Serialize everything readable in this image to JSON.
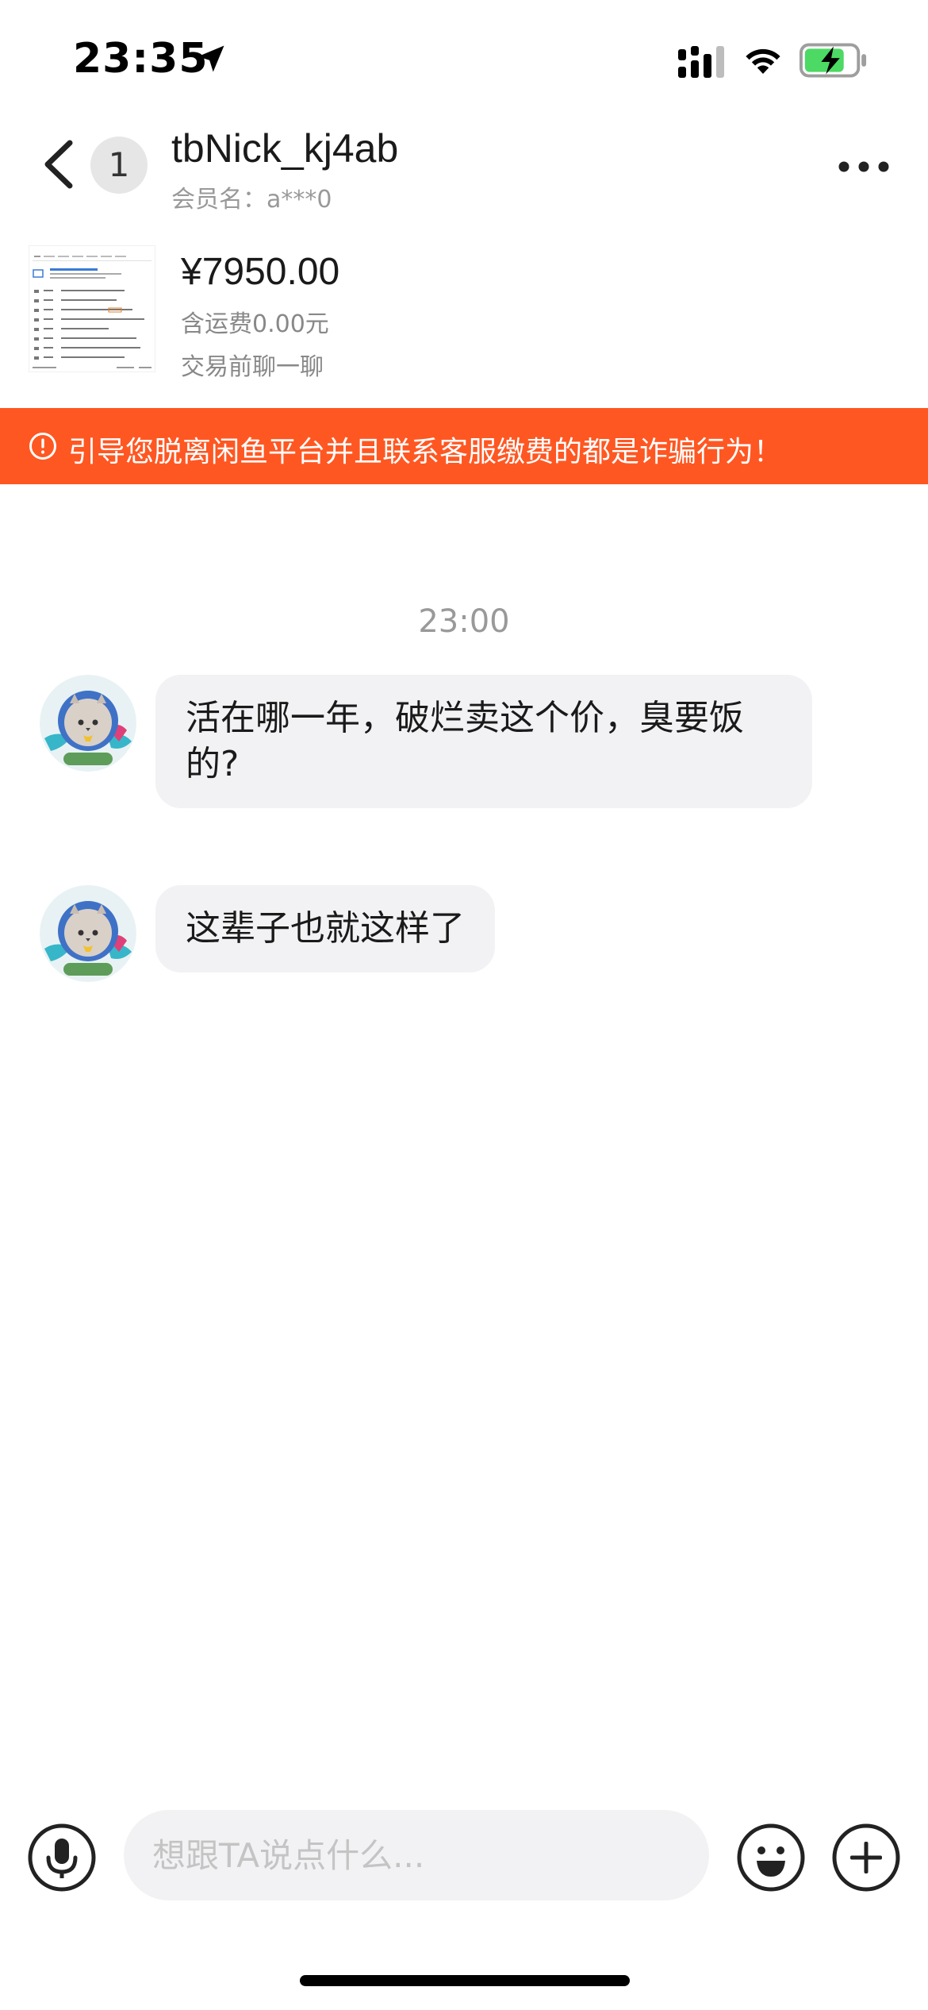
{
  "status_bar": {
    "time": "23:35",
    "icons": [
      "location-arrow-icon",
      "signal-icon",
      "wifi-icon",
      "battery-charging-icon"
    ],
    "battery_color": "#4cd964"
  },
  "header": {
    "back_icon": "chevron-left-icon",
    "unread_count": "1",
    "nickname": "tbNick_kj4ab",
    "member_name": "会员名：a***0",
    "more_icon": "more-dots-icon"
  },
  "product": {
    "price": "¥7950.00",
    "shipping": "含运费0.00元",
    "status": "交易前聊一聊"
  },
  "warning": {
    "icon": "alert-circle-icon",
    "text": "引导您脱离闲鱼平台并且联系客服缴费的都是诈骗行为！",
    "color": "#ff5722"
  },
  "chat": {
    "timestamp": "23:00",
    "messages": [
      {
        "sender": "other",
        "text": "活在哪一年，破烂卖这个价，臭要饭的?"
      },
      {
        "sender": "other",
        "text": "这辈子也就这样了"
      }
    ]
  },
  "input_bar": {
    "placeholder": "想跟TA说点什么...",
    "voice_icon": "microphone-icon",
    "emoji_icon": "emoji-icon",
    "plus_icon": "plus-circle-icon"
  }
}
